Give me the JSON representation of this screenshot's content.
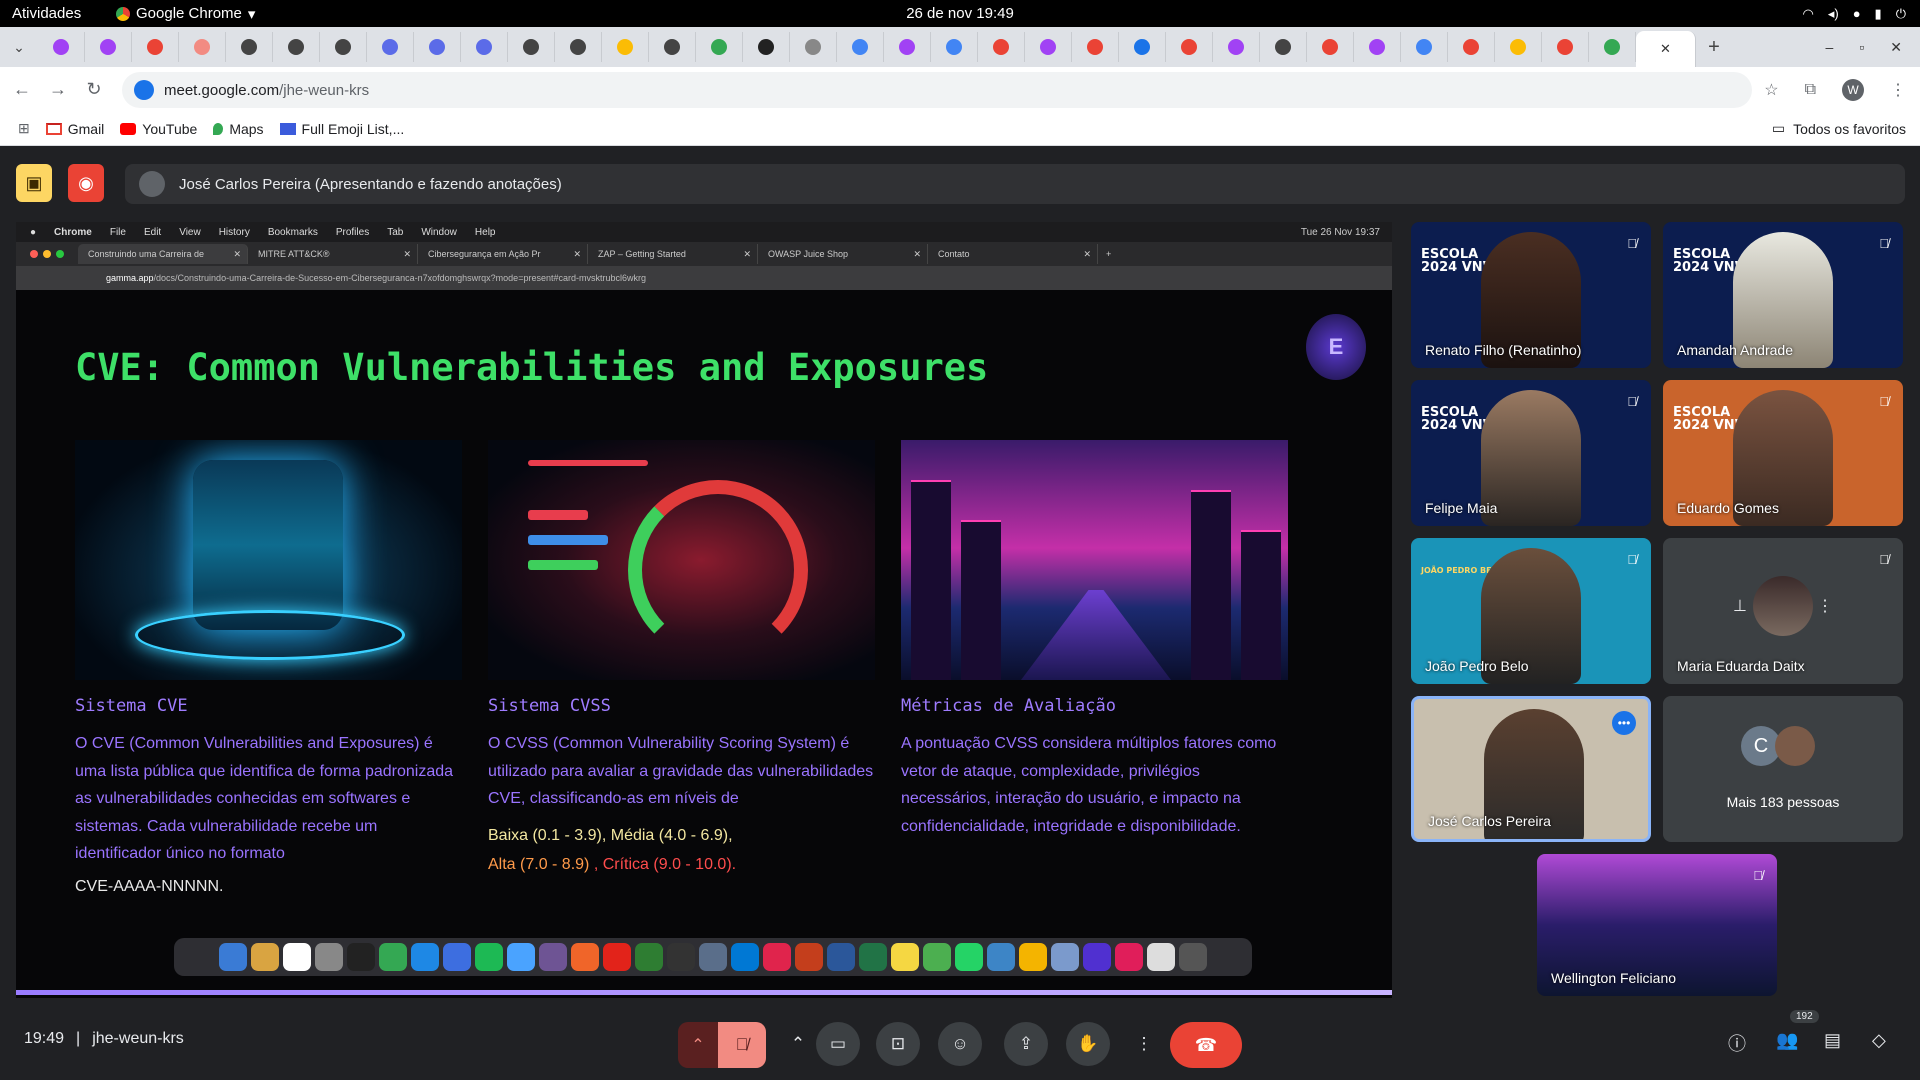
{
  "system": {
    "activities": "Atividades",
    "app_name": "Google Chrome",
    "datetime": "26 de nov  19:49"
  },
  "browser": {
    "tabs_count_visible": 34,
    "url_host": "meet.google.com",
    "url_path": "/jhe-weun-krs",
    "profile_initial": "W",
    "bookmarks": [
      "Gmail",
      "YouTube",
      "Maps",
      "Full Emoji List,..."
    ],
    "all_bookmarks": "Todos os favoritos"
  },
  "meet": {
    "presenter_label": "José Carlos Pereira (Apresentando e fazendo anotações)",
    "time": "19:49",
    "meeting_code": "jhe-weun-krs",
    "participants_badge": "192"
  },
  "shared": {
    "menu": [
      "Chrome",
      "File",
      "Edit",
      "View",
      "History",
      "Bookmarks",
      "Profiles",
      "Tab",
      "Window",
      "Help"
    ],
    "menu_clock": "Tue 26 Nov  19:37",
    "tabs": [
      "Construindo uma Carreira de",
      "MITRE ATT&CK®",
      "Cibersegurança em Ação Pr",
      "ZAP – Getting Started",
      "OWASP Juice Shop",
      "Contato"
    ],
    "url_host": "gamma.app",
    "url_path": "/docs/Construindo-uma-Carreira-de-Sucesso-em-Ciberseguranca-n7xofdomghswrqx?mode=present#card-mvsktrubcl6wkrg"
  },
  "slide": {
    "title": "CVE: Common Vulnerabilities and Exposures",
    "logo_text": "E",
    "columns": [
      {
        "heading": "Sistema CVE",
        "body": "O CVE (Common Vulnerabilities and Exposures) é uma lista pública que identifica de forma padronizada as vulnerabilidades conhecidas em softwares e sistemas. Cada vulnerabilidade recebe um identificador único no formato",
        "extra": "CVE-AAAA-NNNNN."
      },
      {
        "heading": "Sistema CVSS",
        "body": "O CVSS (Common Vulnerability Scoring System) é utilizado para avaliar a gravidade das vulnerabilidades CVE, classificando-as em níveis de",
        "levels": {
          "low": "Baixa (0.1 - 3.9),",
          "medium": "Média (4.0 - 6.9),",
          "high": "Alta (7.0 - 8.9)",
          "critical": ", Crítica (9.0 - 10.0)."
        }
      },
      {
        "heading": "Métricas de Avaliação",
        "body": "A pontuação CVSS considera múltiplos fatores como vetor de ataque, complexidade, privilégios necessários, interação do usuário, e impacto na confidencialidade, integridade e disponibilidade."
      }
    ]
  },
  "participants": [
    {
      "name": "Renato Filho (Renatinho)",
      "brand": "ESCOLA\n2024 VNW"
    },
    {
      "name": "Amandah Andrade",
      "brand": "ESCOLA\n2024 VNW"
    },
    {
      "name": "Felipe Maia",
      "brand": "ESCOLA\n2024 VNW"
    },
    {
      "name": "Eduardo Gomes",
      "brand": "ESCOLA\n2024 VNW"
    },
    {
      "name": "João Pedro Belo",
      "brand": "JOÃO PEDRO BELO"
    },
    {
      "name": "Maria Eduarda Daitx",
      "brand": ""
    },
    {
      "name": "José Carlos Pereira",
      "brand": ""
    },
    {
      "name": "Mais 183 pessoas",
      "brand": "C"
    },
    {
      "name": "Wellington Feliciano",
      "brand": ""
    }
  ]
}
